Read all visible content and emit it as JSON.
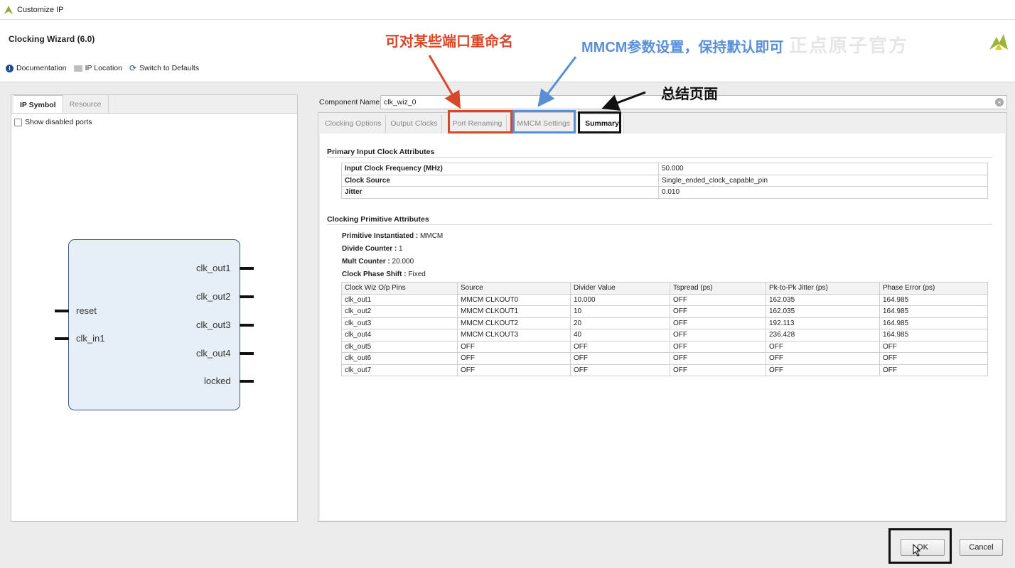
{
  "window": {
    "title": "Customize IP"
  },
  "header": {
    "wizard_title": "Clocking Wizard (6.0)",
    "toolbar": [
      {
        "label": "Documentation",
        "icon": "info-icon"
      },
      {
        "label": "IP Location",
        "icon": "folder-icon"
      },
      {
        "label": "Switch to Defaults",
        "icon": "refresh-icon"
      }
    ],
    "watermark": "正点原子官方"
  },
  "left_panel": {
    "tabs": [
      "IP Symbol",
      "Resource"
    ],
    "active_tab": "IP Symbol",
    "show_disabled_ports_label": "Show disabled ports",
    "show_disabled_ports_checked": false,
    "symbol": {
      "inputs": [
        "reset",
        "clk_in1"
      ],
      "outputs": [
        "clk_out1",
        "clk_out2",
        "clk_out3",
        "clk_out4",
        "locked"
      ]
    }
  },
  "component": {
    "label": "Component Name",
    "value": "clk_wiz_0"
  },
  "right_tabs": [
    "Clocking Options",
    "Output Clocks",
    "Port Renaming",
    "MMCM Settings",
    "Summary"
  ],
  "active_right_tab": "Summary",
  "summary": {
    "primary_title": "Primary Input Clock Attributes",
    "primary_rows": [
      [
        "Input Clock Frequency (MHz)",
        "50.000"
      ],
      [
        "Clock Source",
        "Single_ended_clock_capable_pin"
      ],
      [
        "Jitter",
        "0.010"
      ]
    ],
    "primitive_title": "Clocking Primitive Attributes",
    "primitive": [
      {
        "label": "Primitive Instantiated :",
        "value": "MMCM"
      },
      {
        "label": "Divide Counter :",
        "value": "1"
      },
      {
        "label": "Mult Counter :",
        "value": "20.000"
      },
      {
        "label": "Clock Phase Shift :",
        "value": "Fixed"
      }
    ],
    "clock_table": {
      "headers": [
        "Clock Wiz O/p Pins",
        "Source",
        "Divider Value",
        "Tspread (ps)",
        "Pk-to-Pk Jitter (ps)",
        "Phase Error (ps)"
      ],
      "rows": [
        [
          "clk_out1",
          "MMCM CLKOUT0",
          "10.000",
          "OFF",
          "162.035",
          "164.985"
        ],
        [
          "clk_out2",
          "MMCM CLKOUT1",
          "10",
          "OFF",
          "162.035",
          "164.985"
        ],
        [
          "clk_out3",
          "MMCM CLKOUT2",
          "20",
          "OFF",
          "192.113",
          "164.985"
        ],
        [
          "clk_out4",
          "MMCM CLKOUT3",
          "40",
          "OFF",
          "236.428",
          "164.985"
        ],
        [
          "clk_out5",
          "OFF",
          "OFF",
          "OFF",
          "OFF",
          "OFF"
        ],
        [
          "clk_out6",
          "OFF",
          "OFF",
          "OFF",
          "OFF",
          "OFF"
        ],
        [
          "clk_out7",
          "OFF",
          "OFF",
          "OFF",
          "OFF",
          "OFF"
        ]
      ]
    }
  },
  "buttons": {
    "ok": "OK",
    "cancel": "Cancel"
  },
  "annotations": {
    "port_renaming_note": "可对某些端口重命名",
    "mmcm_note": "MMCM参数设置，保持默认即可",
    "summary_note": "总结页面",
    "colors": {
      "red": "#d9472b",
      "blue": "#5a8fd6",
      "black": "#111111"
    }
  }
}
